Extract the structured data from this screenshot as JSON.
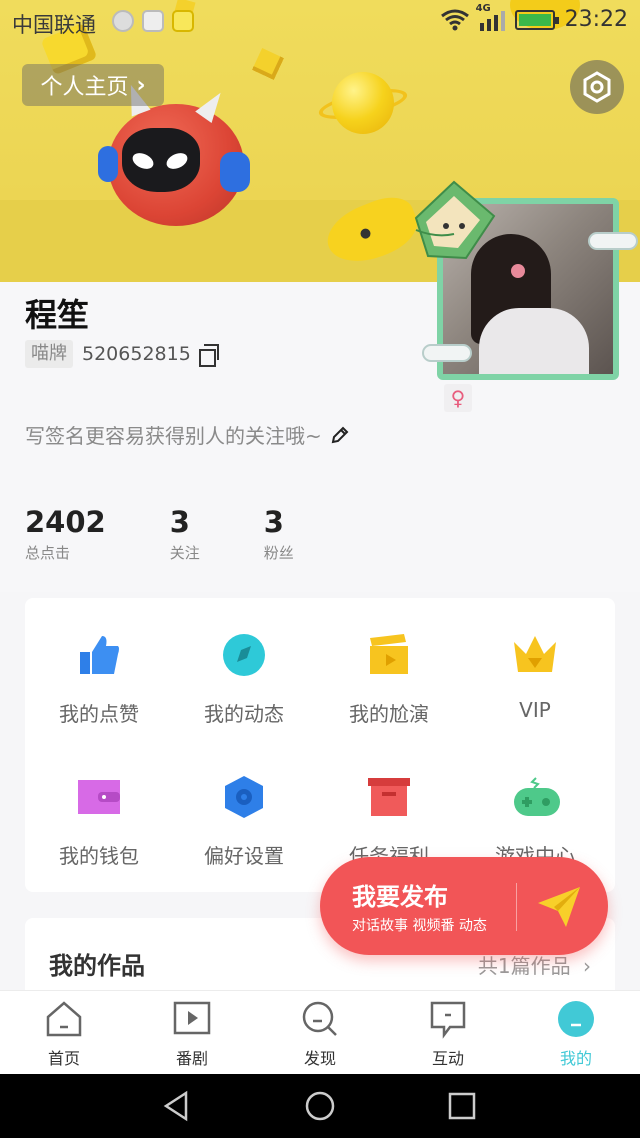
{
  "status_bar": {
    "carrier": "中国联通",
    "network": "4G",
    "time": "23:22"
  },
  "header": {
    "home_label": "个人主页",
    "settings_icon": "hexagon-settings-icon",
    "bg_color": "#ebd452"
  },
  "profile": {
    "name": "程笙",
    "tag": "喵牌",
    "uid": "520652815",
    "gender_symbol": "♀",
    "signature": "写签名更容易获得别人的关注哦~"
  },
  "stats": [
    {
      "value": "2402",
      "label": "总点击"
    },
    {
      "value": "3",
      "label": "关注"
    },
    {
      "value": "3",
      "label": "粉丝"
    }
  ],
  "grid": [
    {
      "label": "我的点赞",
      "icon": "thumbs-up-icon",
      "color": "#2e7fe8"
    },
    {
      "label": "我的动态",
      "icon": "compass-icon",
      "color": "#2ec9d8"
    },
    {
      "label": "我的尬演",
      "icon": "clapperboard-icon",
      "color": "#f7c41f"
    },
    {
      "label": "VIP",
      "icon": "crown-icon",
      "color": "#f7c41f"
    },
    {
      "label": "我的钱包",
      "icon": "wallet-icon",
      "color": "#d76ae6"
    },
    {
      "label": "偏好设置",
      "icon": "hexagon-gear-icon",
      "color": "#2e7fe8"
    },
    {
      "label": "任务福利",
      "icon": "gift-box-icon",
      "color": "#f05a5a"
    },
    {
      "label": "游戏中心",
      "icon": "gamepad-icon",
      "color": "#4ec98a"
    }
  ],
  "works": {
    "title": "我的作品",
    "count": "共1篇作品"
  },
  "publish": {
    "title": "我要发布",
    "subtitle": "对话故事 视频番 动态"
  },
  "tabs": [
    {
      "label": "首页",
      "icon": "home-icon"
    },
    {
      "label": "番剧",
      "icon": "play-icon"
    },
    {
      "label": "发现",
      "icon": "search-icon"
    },
    {
      "label": "互动",
      "icon": "chat-icon"
    },
    {
      "label": "我的",
      "icon": "profile-face-icon",
      "active": true
    }
  ],
  "accent_color": "#41c9d6"
}
